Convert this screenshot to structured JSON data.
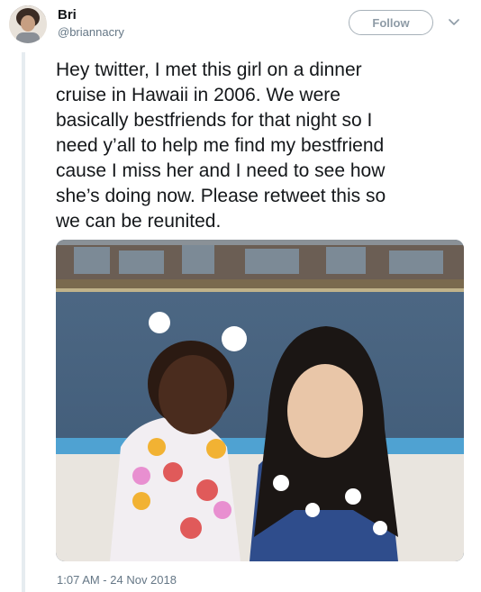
{
  "user": {
    "name": "Bri",
    "handle": "@briannacry"
  },
  "follow_label": "Follow",
  "tweet": {
    "text": "Hey twitter, I met this girl on a dinner\ncruise in Hawaii in 2006. We were\nbasically bestfriends for that night so I\nneed y’all to help me find my bestfriend\ncause I miss her and I need to see how\nshe’s doing now. Please retweet this so\nwe can be reunited.",
    "timestamp": "1:07 AM - 24 Nov 2018"
  },
  "colors": {
    "text": "#14171a",
    "secondary": "#657786",
    "border": "#a7b1b9"
  },
  "icons": [
    "chevron-down-icon"
  ]
}
